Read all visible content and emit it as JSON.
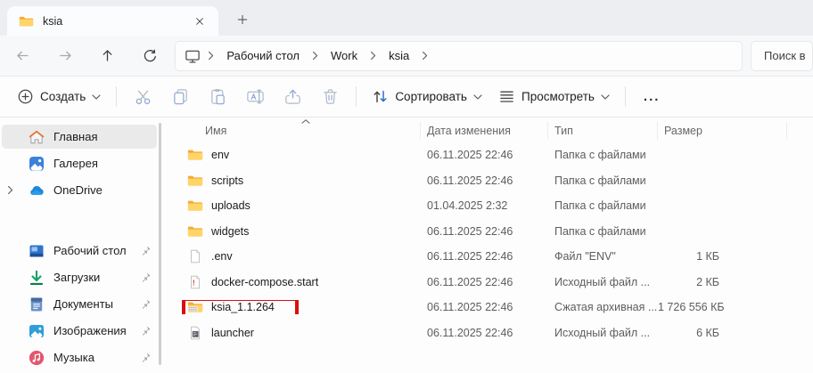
{
  "window": {
    "tab_title": "ksia"
  },
  "nav": {
    "breadcrumb": [
      "Рабочий стол",
      "Work",
      "ksia"
    ],
    "search_placeholder": "Поиск в"
  },
  "toolbar": {
    "new_label": "Создать",
    "sort_label": "Сортировать",
    "view_label": "Просмотреть",
    "more_label": "..."
  },
  "sidebar": {
    "items": [
      {
        "label": "Главная",
        "icon": "home",
        "selected": true,
        "chevron": false,
        "pinned": false
      },
      {
        "label": "Галерея",
        "icon": "gallery",
        "selected": false,
        "chevron": false,
        "pinned": false
      },
      {
        "label": "OneDrive",
        "icon": "onedrive",
        "selected": false,
        "chevron": true,
        "pinned": false,
        "gap_after": true
      },
      {
        "label": "Рабочий стол",
        "icon": "desktop",
        "selected": false,
        "chevron": false,
        "pinned": true
      },
      {
        "label": "Загрузки",
        "icon": "downloads",
        "selected": false,
        "chevron": false,
        "pinned": true
      },
      {
        "label": "Документы",
        "icon": "documents",
        "selected": false,
        "chevron": false,
        "pinned": true
      },
      {
        "label": "Изображения",
        "icon": "pictures",
        "selected": false,
        "chevron": false,
        "pinned": true
      },
      {
        "label": "Музыка",
        "icon": "music",
        "selected": false,
        "chevron": false,
        "pinned": true
      }
    ]
  },
  "files": {
    "columns": [
      "Имя",
      "Дата изменения",
      "Тип",
      "Размер"
    ],
    "rows": [
      {
        "name": "env",
        "date": "06.11.2025 22:46",
        "type": "Папка с файлами",
        "size": "",
        "icon": "folder",
        "highlighted": false
      },
      {
        "name": "scripts",
        "date": "06.11.2025 22:46",
        "type": "Папка с файлами",
        "size": "",
        "icon": "folder",
        "highlighted": false
      },
      {
        "name": "uploads",
        "date": "01.04.2025 2:32",
        "type": "Папка с файлами",
        "size": "",
        "icon": "folder",
        "highlighted": false
      },
      {
        "name": "widgets",
        "date": "06.11.2025 22:46",
        "type": "Папка с файлами",
        "size": "",
        "icon": "folder",
        "highlighted": false
      },
      {
        "name": ".env",
        "date": "06.11.2025 22:46",
        "type": "Файл \"ENV\"",
        "size": "1 КБ",
        "icon": "file",
        "highlighted": false
      },
      {
        "name": "docker-compose.start",
        "date": "06.11.2025 22:46",
        "type": "Исходный файл ...",
        "size": "2 КБ",
        "icon": "file-exclaim",
        "highlighted": false
      },
      {
        "name": "ksia_1.1.264",
        "date": "06.11.2025 22:46",
        "type": "Сжатая архивная ...",
        "size": "1 726 556 КБ",
        "icon": "zip-folder",
        "highlighted": true
      },
      {
        "name": "launcher",
        "date": "06.11.2025 22:46",
        "type": "Исходный файл ...",
        "size": "6 КБ",
        "icon": "file-script",
        "highlighted": false
      }
    ]
  },
  "colors": {
    "accent": "#2569c9",
    "highlight_box": "#d90f0f",
    "folder_yellow": "#ffd56a"
  }
}
